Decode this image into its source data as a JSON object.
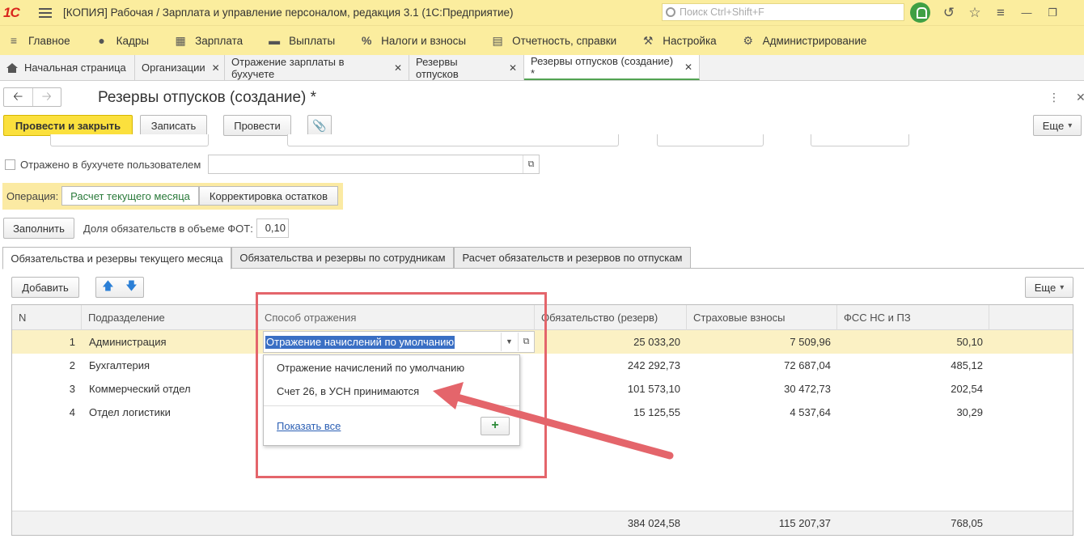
{
  "titlebar": {
    "logo": "1С",
    "title": "[КОПИЯ] Рабочая / Зарплата и управление персоналом, редакция 3.1  (1С:Предприятие)",
    "search_placeholder": "Поиск Ctrl+Shift+F"
  },
  "main_menu": {
    "items": [
      {
        "label": "Главное",
        "icon": "hamburger-icon"
      },
      {
        "label": "Кадры",
        "icon": "people-icon"
      },
      {
        "label": "Зарплата",
        "icon": "calculator-icon"
      },
      {
        "label": "Выплаты",
        "icon": "wallet-icon"
      },
      {
        "label": "Налоги и взносы",
        "icon": "percent-icon"
      },
      {
        "label": "Отчетность, справки",
        "icon": "document-icon"
      },
      {
        "label": "Настройка",
        "icon": "wrench-icon"
      },
      {
        "label": "Администрирование",
        "icon": "gear-icon"
      }
    ]
  },
  "open_tabs": [
    {
      "label": "Начальная страница"
    },
    {
      "label": "Организации"
    },
    {
      "label": "Отражение зарплаты в бухучете"
    },
    {
      "label": "Резервы отпусков"
    },
    {
      "label": "Резервы отпусков (создание) *"
    }
  ],
  "form": {
    "title": "Резервы отпусков (создание) *",
    "buttons": {
      "post_close": "Провести и закрыть",
      "save": "Записать",
      "post": "Провести",
      "more": "Еще"
    },
    "reflected_label": "Отражено в бухучете пользователем",
    "operation_label": "Операция:",
    "operation_options": [
      "Расчет текущего месяца",
      "Корректировка остатков"
    ],
    "fill_button": "Заполнить",
    "share_label": "Доля обязательств в объеме ФОТ:",
    "share_value": "0,10"
  },
  "page_tabs": [
    "Обязательства и резервы текущего месяца",
    "Обязательства и резервы по сотрудникам",
    "Расчет обязательств и резервов по отпускам"
  ],
  "table": {
    "add_button": "Добавить",
    "more_button": "Еще",
    "columns": [
      "N",
      "Подразделение",
      "Способ отражения",
      "Обязательство (резерв)",
      "Страховые взносы",
      "ФСС НС и ПЗ"
    ],
    "rows": [
      {
        "n": "1",
        "dept": "Администрация",
        "method": "Отражение начислений по умолчанию",
        "liability": "25 033,20",
        "insurance": "7 509,96",
        "fss": "50,10"
      },
      {
        "n": "2",
        "dept": "Бухгалтерия",
        "method": "",
        "liability": "242 292,73",
        "insurance": "72 687,04",
        "fss": "485,12"
      },
      {
        "n": "3",
        "dept": "Коммерческий отдел",
        "method": "",
        "liability": "101 573,10",
        "insurance": "30 472,73",
        "fss": "202,54"
      },
      {
        "n": "4",
        "dept": "Отдел логистики",
        "method": "",
        "liability": "15 125,55",
        "insurance": "4 537,64",
        "fss": "30,29"
      }
    ],
    "totals": {
      "liability": "384 024,58",
      "insurance": "115 207,37",
      "fss": "768,05"
    }
  },
  "dropdown": {
    "items": [
      "Отражение начислений по умолчанию",
      "Счет 26, в УСН принимаются"
    ],
    "show_all": "Показать все",
    "add": "+"
  },
  "colors": {
    "header_bg": "#fbed9e",
    "primary_button": "#fbe03d",
    "annotation": "#e4656b",
    "selected_row": "#fbf1c4"
  }
}
